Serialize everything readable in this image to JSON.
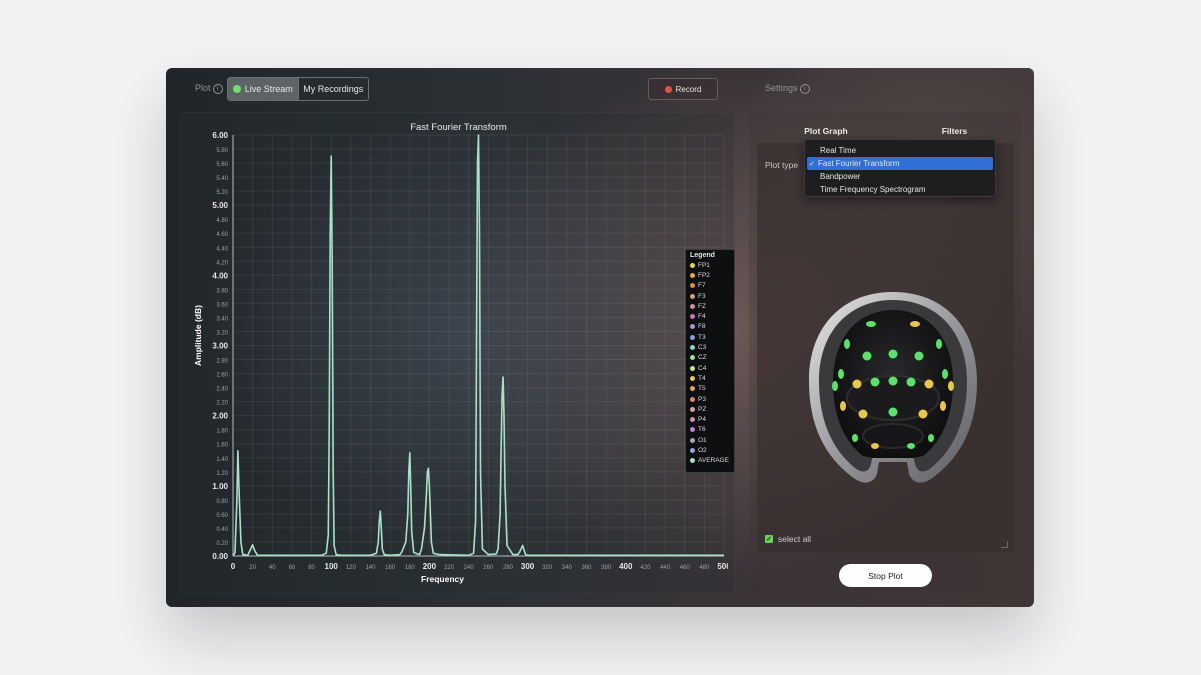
{
  "topbar": {
    "plot_label": "Plot",
    "segments": [
      "Live Stream",
      "My Recordings"
    ],
    "record_label": "Record",
    "settings_label": "Settings",
    "info_glyph": "i"
  },
  "chart_data": {
    "type": "line",
    "title": "Fast Fourier Transform",
    "xlabel": "Frequency",
    "ylabel": "Amplitude (dB)",
    "xlim": [
      0,
      500
    ],
    "ylim": [
      0,
      6
    ],
    "xticks": [
      0,
      20,
      40,
      60,
      80,
      100,
      120,
      140,
      160,
      180,
      200,
      220,
      240,
      260,
      280,
      300,
      320,
      340,
      360,
      380,
      400,
      420,
      440,
      460,
      480,
      500
    ],
    "yticks": [
      0.0,
      0.2,
      0.4,
      0.6,
      0.8,
      1.0,
      1.2,
      1.4,
      1.6,
      1.8,
      2.0,
      2.2,
      2.4,
      2.6,
      2.8,
      3.0,
      3.2,
      3.4,
      3.6,
      3.8,
      4.0,
      4.2,
      4.4,
      4.6,
      4.8,
      5.0,
      5.2,
      5.4,
      5.6,
      5.8,
      6.0
    ],
    "grid": true,
    "legend_position": "right",
    "series": [
      {
        "name": "AVERAGE",
        "color": "#a9e3c6",
        "x": [
          0,
          2,
          4,
          5,
          6,
          8,
          10,
          15,
          18,
          20,
          22,
          25,
          30,
          60,
          90,
          95,
          97,
          98,
          99,
          100,
          101,
          102,
          103,
          105,
          110,
          140,
          146,
          148,
          149,
          150,
          151,
          152,
          154,
          160,
          170,
          172,
          176,
          178,
          179,
          180,
          181,
          182,
          184,
          190,
          192,
          195,
          197,
          198,
          199,
          200,
          201,
          202,
          204,
          210,
          240,
          245,
          247,
          248,
          249,
          250,
          251,
          252,
          254,
          260,
          268,
          270,
          272,
          273,
          274,
          275,
          276,
          277,
          279,
          285,
          290,
          292,
          294,
          295,
          296,
          298,
          300,
          310,
          350,
          400,
          450,
          500
        ],
        "y": [
          0,
          0.05,
          0.8,
          1.5,
          1.0,
          0.2,
          0.02,
          0.01,
          0.1,
          0.16,
          0.08,
          0.01,
          0.01,
          0.01,
          0.01,
          0.04,
          0.3,
          1.8,
          4.6,
          5.7,
          4.2,
          1.2,
          0.15,
          0.02,
          0.01,
          0.01,
          0.04,
          0.2,
          0.5,
          0.64,
          0.4,
          0.1,
          0.02,
          0.01,
          0.02,
          0.06,
          0.2,
          0.6,
          1.2,
          1.47,
          1.0,
          0.35,
          0.05,
          0.02,
          0.1,
          0.4,
          0.9,
          1.2,
          1.25,
          1.0,
          0.6,
          0.2,
          0.04,
          0.02,
          0.01,
          0.04,
          0.5,
          3.0,
          5.6,
          6.0,
          4.6,
          1.2,
          0.1,
          0.02,
          0.03,
          0.1,
          0.6,
          1.5,
          2.3,
          2.55,
          2.0,
          1.0,
          0.15,
          0.02,
          0.02,
          0.06,
          0.12,
          0.15,
          0.1,
          0.02,
          0.01,
          0.01,
          0.01,
          0.01,
          0.01,
          0.01
        ]
      }
    ]
  },
  "legend": {
    "title": "Legend",
    "items": [
      {
        "label": "FP1",
        "color": "#e8d24a"
      },
      {
        "label": "FP2",
        "color": "#e8a64a"
      },
      {
        "label": "F7",
        "color": "#e88a4a"
      },
      {
        "label": "F3",
        "color": "#d8a07a"
      },
      {
        "label": "FZ",
        "color": "#d88aa0"
      },
      {
        "label": "F4",
        "color": "#c878b8"
      },
      {
        "label": "F8",
        "color": "#b88ad8"
      },
      {
        "label": "T3",
        "color": "#8a9ae8"
      },
      {
        "label": "C3",
        "color": "#7ad8c8"
      },
      {
        "label": "CZ",
        "color": "#8ae8a0"
      },
      {
        "label": "C4",
        "color": "#c8e88a"
      },
      {
        "label": "T4",
        "color": "#e8c84a"
      },
      {
        "label": "T5",
        "color": "#e8a84a"
      },
      {
        "label": "P3",
        "color": "#e8884a"
      },
      {
        "label": "PZ",
        "color": "#d8a0a0"
      },
      {
        "label": "P4",
        "color": "#d88ab8"
      },
      {
        "label": "T6",
        "color": "#c87ad8"
      },
      {
        "label": "O1",
        "color": "#a8a0c8"
      },
      {
        "label": "O2",
        "color": "#8aa8e8"
      },
      {
        "label": "AVERAGE",
        "color": "#a9e3c6"
      }
    ]
  },
  "right_panel": {
    "tabs": [
      "Plot Graph",
      "Filters"
    ],
    "plot_type_label": "Plot type",
    "plot_type_options": [
      "Real Time",
      "Fast Fourier Transform",
      "Bandpower",
      "Time Frequency Spectrogram"
    ],
    "selected_option": "Fast Fourier Transform",
    "check_glyph": "✓",
    "select_all_label": "select all",
    "stop_plot_label": "Stop Plot"
  }
}
